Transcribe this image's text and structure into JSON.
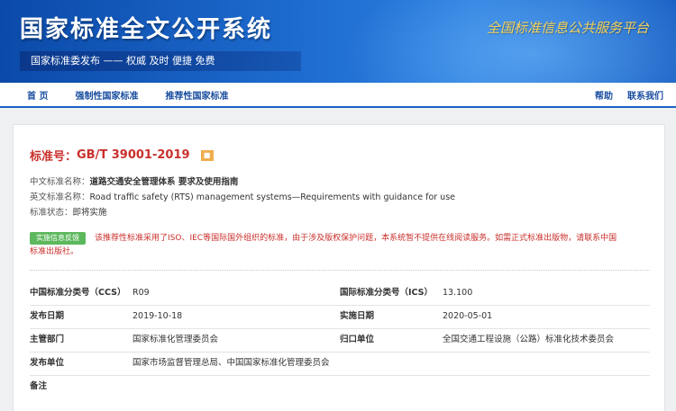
{
  "header": {
    "title": "国家标准全文公开系统",
    "slogan": "国家标准委发布 —— 权威 及时 便捷 免费",
    "platform": "全国标准信息公共服务平台"
  },
  "nav": {
    "home": "首 页",
    "mandatory": "强制性国家标准",
    "recommended": "推荐性国家标准",
    "help": "帮助",
    "contact": "联系我们"
  },
  "standard": {
    "number_prefix": "标准号：",
    "number": "GB/T 39001-2019",
    "cn_name_label": "中文标准名称：",
    "cn_name": "道路交通安全管理体系 要求及使用指南",
    "en_name_label": "英文标准名称：",
    "en_name": "Road traffic safety (RTS) management systems—Requirements with guidance for use",
    "status_label": "标准状态：",
    "status": "即将实施",
    "feedback_button": "实施信息反馈",
    "notice": "该推荐性标准采用了ISO、IEC等国际国外组织的标准，由于涉及版权保护问题，本系统暂不提供在线阅读服务。如需正式标准出版物，请联系中国标准出版社。"
  },
  "details": {
    "ccs_label": "中国标准分类号（CCS）",
    "ccs": "R09",
    "ics_label": "国际标准分类号（ICS）",
    "ics": "13.100",
    "pub_date_label": "发布日期",
    "pub_date": "2019-10-18",
    "impl_date_label": "实施日期",
    "impl_date": "2020-05-01",
    "dept_label": "主管部门",
    "dept": "国家标准化管理委员会",
    "owner_label": "归口单位",
    "owner": "全国交通工程设施（公路）标准化技术委员会",
    "publisher_label": "发布单位",
    "publisher": "国家市场监督管理总局、中国国家标准化管理委员会",
    "remark_label": "备注",
    "remark": ""
  }
}
